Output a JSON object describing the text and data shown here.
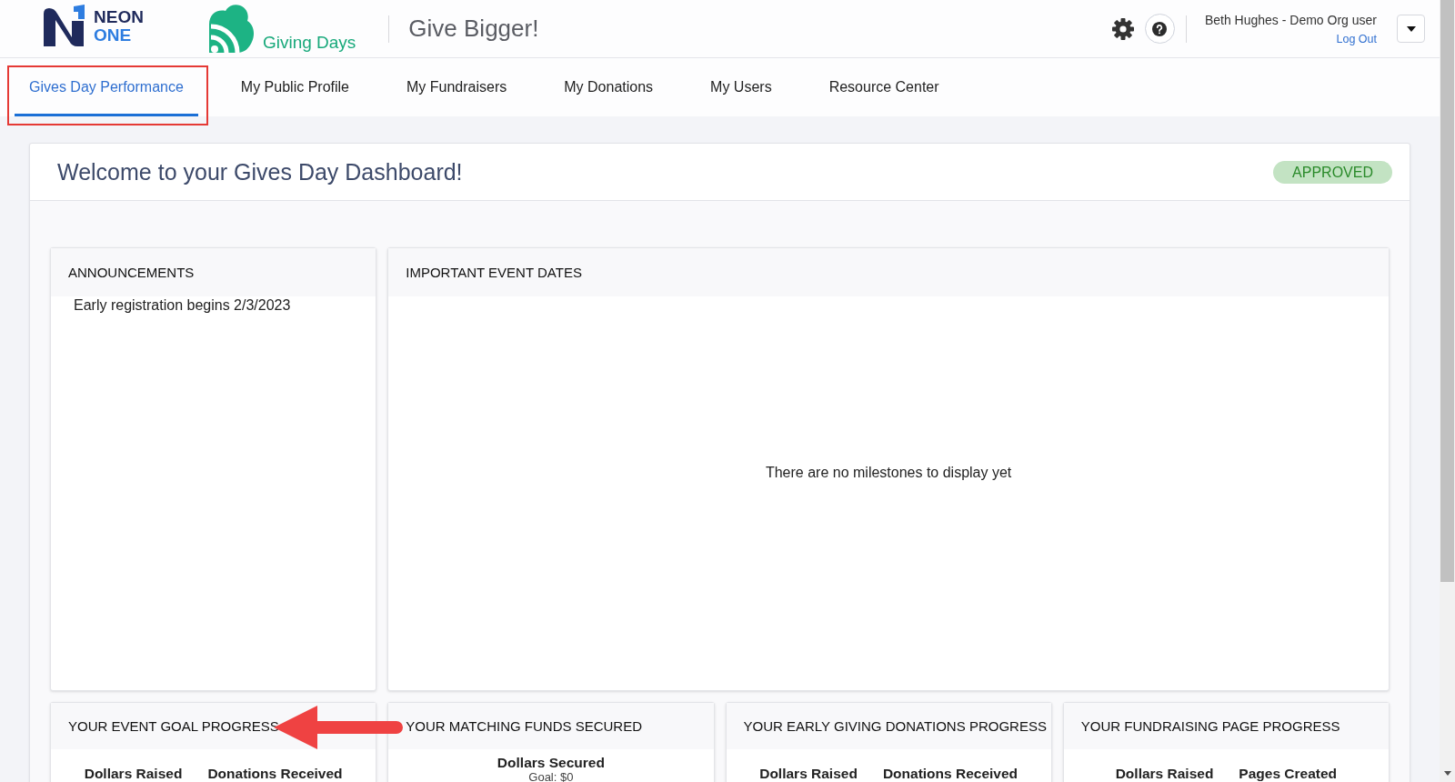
{
  "header": {
    "logo": {
      "line_1": "NEON",
      "line_2": "ONE"
    },
    "product": {
      "name": "Giving Days"
    },
    "tagline": "Give Bigger!",
    "user": {
      "name": "Beth Hughes - Demo Org user",
      "logout": "Log Out"
    }
  },
  "tabs": [
    {
      "label": "Gives Day Performance",
      "selected": true,
      "highlighted": true
    },
    {
      "label": "My Public Profile",
      "selected": false,
      "highlighted": false
    },
    {
      "label": "My Fundraisers",
      "selected": false,
      "highlighted": false
    },
    {
      "label": "My Donations",
      "selected": false,
      "highlighted": false
    },
    {
      "label": "My Users",
      "selected": false,
      "highlighted": false
    },
    {
      "label": "Resource Center",
      "selected": false,
      "highlighted": false
    }
  ],
  "dashboard": {
    "title": "Welcome to your Gives Day Dashboard!",
    "status": {
      "label": "APPROVED",
      "kind": "approved"
    }
  },
  "panels": [
    {
      "title": "ANNOUNCEMENTS",
      "items": [
        "Early registration begins 2/3/2023"
      ]
    },
    {
      "title": "IMPORTANT EVENT DATES",
      "empty_message": "There are no milestones to display yet"
    }
  ],
  "progress_cards": [
    {
      "title": "YOUR EVENT GOAL PROGRESS",
      "pointed_at": true,
      "metrics": [
        {
          "label": "Dollars Raised"
        },
        {
          "label": "Donations Received"
        }
      ]
    },
    {
      "title": "YOUR MATCHING FUNDS SECURED",
      "pointed_at": false,
      "metrics": [
        {
          "label": "Dollars Secured",
          "goal": "Goal: $0"
        }
      ]
    },
    {
      "title": "YOUR EARLY GIVING DONATIONS PROGRESS",
      "pointed_at": false,
      "metrics": [
        {
          "label": "Dollars Raised"
        },
        {
          "label": "Donations Received"
        }
      ]
    },
    {
      "title": "YOUR FUNDRAISING PAGE PROGRESS",
      "pointed_at": false,
      "metrics": [
        {
          "label": "Dollars Raised"
        },
        {
          "label": "Pages Created"
        }
      ]
    }
  ]
}
